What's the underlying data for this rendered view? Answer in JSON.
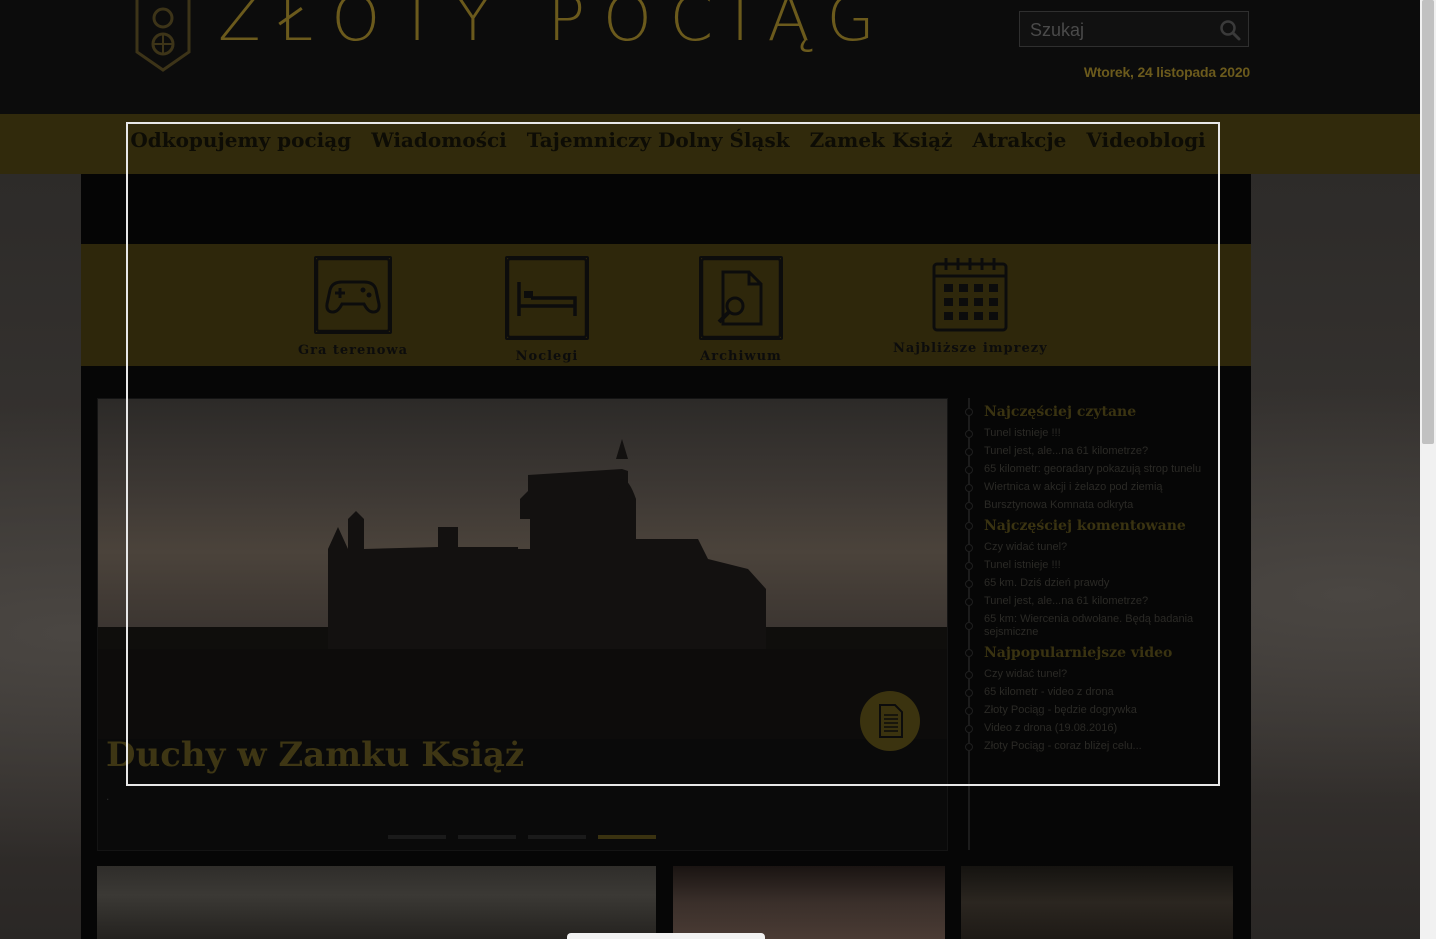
{
  "header": {
    "logo_text": "ZŁOTY POCIĄG",
    "search_placeholder": "Szukaj",
    "date": "Wtorek, 24 listopada 2020"
  },
  "nav": {
    "items": [
      "Odkopujemy pociąg",
      "Wiadomości",
      "Tajemniczy Dolny Śląsk",
      "Zamek Książ",
      "Atrakcje",
      "Videoblogi"
    ]
  },
  "quick_links": [
    {
      "label": "Gra terenowa",
      "icon": "gamepad-icon"
    },
    {
      "label": "Noclegi",
      "icon": "bed-icon"
    },
    {
      "label": "Archiwum",
      "icon": "document-search-icon"
    },
    {
      "label": "Najbliższe imprezy",
      "icon": "calendar-icon"
    }
  ],
  "slider": {
    "title": "Duchy w Zamku Książ",
    "subtitle": ".",
    "dot_count": 4,
    "active_dot": 4
  },
  "sidebar": {
    "most_read": {
      "title": "Najczęściej czytane",
      "items": [
        "Tunel istnieje !!!",
        "Tunel jest, ale...na 61 kilometrze?",
        "65 kilometr: georadary pokazują strop tunelu",
        "Wiertnica w akcji i żelazo pod ziemią",
        "Bursztynowa Komnata odkryta"
      ]
    },
    "most_commented": {
      "title": "Najczęściej komentowane",
      "items": [
        "Czy widać tunel?",
        "Tunel istnieje !!!",
        "65 km. Dziś dzień prawdy",
        "Tunel jest, ale...na 61 kilometrze?",
        "65 km: Wiercenia odwołane. Będą badania sejsmiczne"
      ]
    },
    "popular_video": {
      "title": "Najpopularniejsze video",
      "items": [
        "Czy widać tunel?",
        "65 kilometr - video z drona",
        "Złoty Pociąg - będzie dogrywka",
        "Video z drona (19.08.2016)",
        "Złoty Pociąg - coraz bliżej celu..."
      ]
    }
  },
  "colors": {
    "gold_dim": "#3a3311",
    "header_bg": "#0c0c0c",
    "nav_bg": "#312a0c"
  }
}
